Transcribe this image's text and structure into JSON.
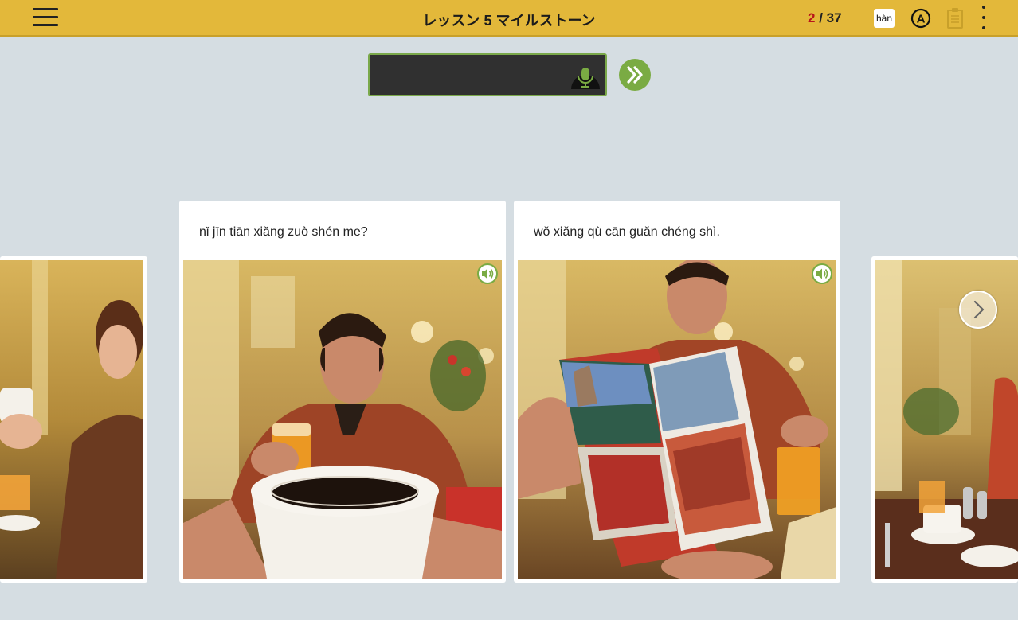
{
  "header": {
    "title": "レッスン 5 マイルストーン",
    "progress_current": "2",
    "progress_separator": "/",
    "progress_total": "37",
    "han_label": "hàn",
    "icons": [
      "menu-icon",
      "auto-a-icon",
      "clipboard-icon",
      "more-vertical-icon"
    ]
  },
  "speech": {
    "value": "",
    "icons": [
      "microphone-icon",
      "double-chevron-right-icon"
    ]
  },
  "cards": [
    {
      "text": "",
      "photo": "woman-smiling-with-cup"
    },
    {
      "text": "nǐ jīn tiān xiǎng zuò shén me?",
      "photo": "man-talking-over-coffee"
    },
    {
      "text": "wǒ xiǎng qù cān guǎn chéng shì.",
      "photo": "man-holding-travel-brochure"
    },
    {
      "text": "",
      "photo": "restaurant-table-with-cups"
    }
  ],
  "colors": {
    "header_bg": "#e3b83a",
    "accent_green": "#7aab43",
    "progress_current": "#b8141b",
    "page_bg": "#d5dde2"
  }
}
